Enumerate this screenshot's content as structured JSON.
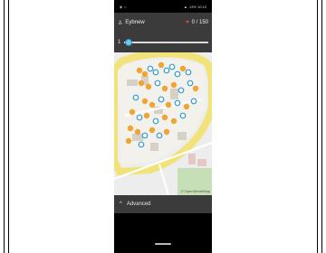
{
  "status": {
    "right_text": "13% 10:10"
  },
  "header": {
    "username": "Eybnew",
    "progress_text": "0 / 150"
  },
  "slider": {
    "value_label": "1",
    "fraction": 0.05
  },
  "map": {
    "attribution": "© OpenStreetMap"
  },
  "bottom": {
    "label": "Advanced"
  },
  "colors": {
    "bar": "#3b3b3b",
    "accent": "#6cc7f0",
    "orange": "#f0a431",
    "blue": "#2e9fd6"
  }
}
